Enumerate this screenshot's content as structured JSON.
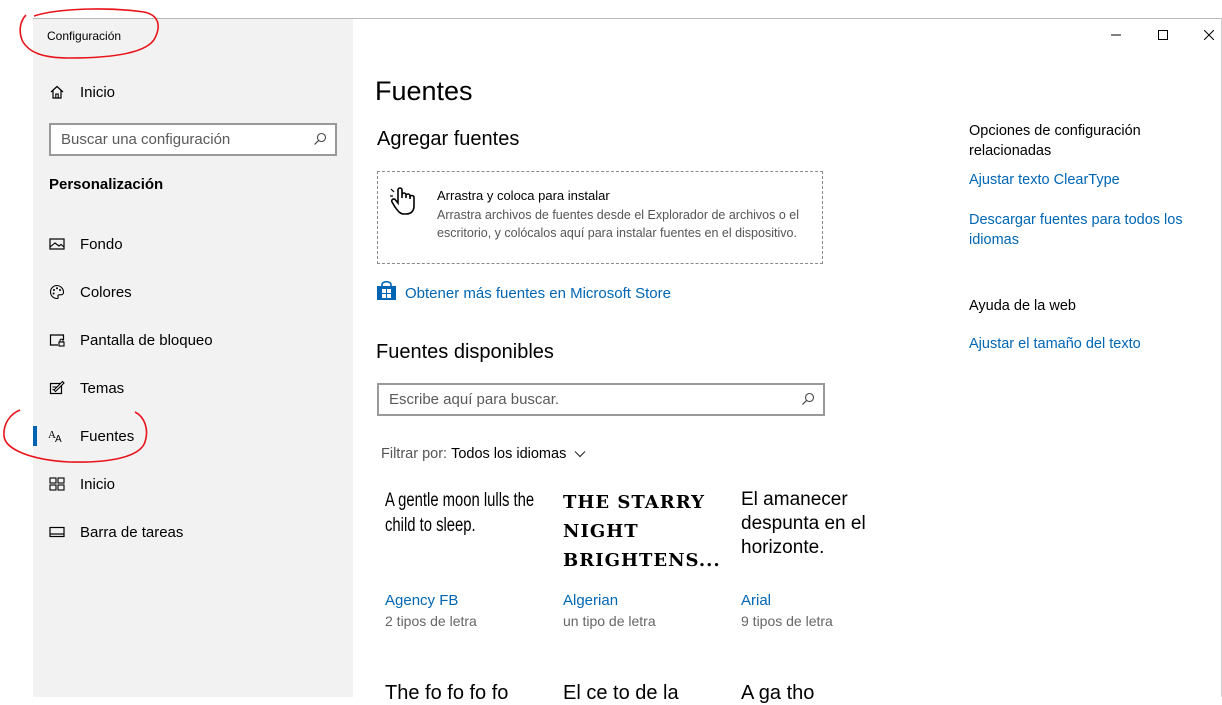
{
  "window": {
    "title": "Configuración",
    "controls": {
      "minimize_icon": "minimize-icon",
      "maximize_icon": "maximize-icon",
      "close_icon": "close-icon"
    }
  },
  "sidebar": {
    "home_label": "Inicio",
    "search_placeholder": "Buscar una configuración",
    "section_title": "Personalización",
    "items": [
      {
        "label": "Fondo",
        "icon": "image-icon"
      },
      {
        "label": "Colores",
        "icon": "palette-icon"
      },
      {
        "label": "Pantalla de bloqueo",
        "icon": "lock-screen-icon"
      },
      {
        "label": "Temas",
        "icon": "themes-icon"
      },
      {
        "label": "Fuentes",
        "icon": "fonts-icon",
        "selected": true
      },
      {
        "label": "Inicio",
        "icon": "start-icon"
      },
      {
        "label": "Barra de tareas",
        "icon": "taskbar-icon"
      }
    ]
  },
  "main": {
    "title": "Fuentes",
    "add_fonts": {
      "heading": "Agregar fuentes",
      "drop_title": "Arrastra y coloca para instalar",
      "drop_desc": "Arrastra archivos de fuentes desde el Explorador de archivos o el escritorio, y colócalos aquí para instalar fuentes en el dispositivo."
    },
    "store_link": "Obtener más fuentes en Microsoft Store",
    "available": {
      "heading": "Fuentes disponibles",
      "search_placeholder": "Escribe aquí para buscar.",
      "filter_label": "Filtrar por:",
      "filter_value": "Todos los idiomas"
    },
    "fonts": [
      {
        "sample": "A gentle moon lulls the child to sleep.",
        "name": "Agency FB",
        "styles": "2 tipos de letra"
      },
      {
        "sample": "The starry night brightens...",
        "name": "Algerian",
        "styles": "un tipo de letra"
      },
      {
        "sample": "El amanecer despunta en el horizonte.",
        "name": "Arial",
        "styles": "9 tipos de letra"
      }
    ],
    "next_row_samples": [
      "The fo fo fo fo",
      "El ce to de la",
      "A ga tho"
    ]
  },
  "related": {
    "heading": "Opciones de configuración relacionadas",
    "links": [
      "Ajustar texto ClearType",
      "Descargar fuentes para todos los idiomas"
    ],
    "help_heading": "Ayuda de la web",
    "help_links": [
      "Ajustar el tamaño del texto"
    ]
  },
  "colors": {
    "accent": "#0066b4",
    "selection_bar": "#0063b1",
    "annotation": "#e8141b",
    "sidebar_bg": "#f2f2f2"
  }
}
